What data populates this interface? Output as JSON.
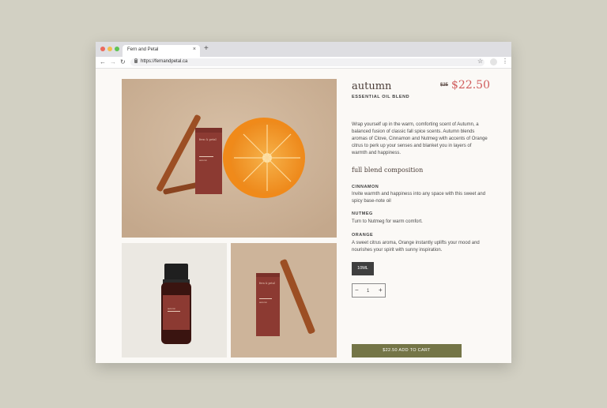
{
  "browser": {
    "tab_title": "Fern and Petal",
    "tab_close": "×",
    "new_tab": "+",
    "url": "https://fernandpetal.ca",
    "back": "←",
    "forward": "→",
    "reload": "↻",
    "bookmark": "☆",
    "menu": "⋮"
  },
  "product": {
    "title": "autumn",
    "old_price": "$25",
    "price": "$22.50",
    "subtitle": "ESSENTIAL OIL BLEND",
    "description": "Wrap yourself up in the warm, comforting scent of Autumn, a balanced fusion of classic fall spice scents. Autumn blends aromas of Clove, Cinnamon and Nutmeg with accents of Orange citrus to perk up your senses and blanket you in layers of warmth and happiness.",
    "composition_heading": "full blend composition",
    "ingredients": [
      {
        "name": "CINNAMON",
        "description": "Invite warmth and happiness into any space with this sweet and spicy base-note oil"
      },
      {
        "name": "NUTMEG",
        "description": "Turn to Nutmeg for warm comfort."
      },
      {
        "name": "ORANGE",
        "description": "A sweet citrus aroma, Orange instantly uplifts your mood and nourishes your spirit with sunny inspiration."
      }
    ],
    "size_option": "10ML",
    "quantity": "1",
    "qty_minus": "−",
    "qty_plus": "+",
    "add_to_cart": "$22.50 ADD TO CART",
    "box_brand": "fern & petal",
    "box_name": "autumn"
  },
  "colors": {
    "accent_price": "#d05c5c",
    "cart_button": "#747547",
    "box": "#8c3a32"
  },
  "icons": [
    "back-arrow-icon",
    "forward-arrow-icon",
    "reload-icon",
    "lock-icon",
    "star-icon",
    "menu-icon",
    "minus-icon",
    "plus-icon"
  ]
}
